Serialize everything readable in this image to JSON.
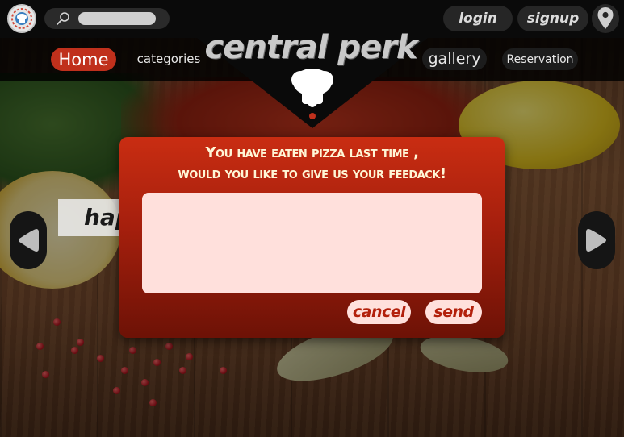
{
  "header": {
    "brand_title": "central perk",
    "search": {
      "value": "",
      "placeholder": ""
    },
    "login_label": "login",
    "signup_label": "signup",
    "location_icon": "map-pin-icon",
    "logo_icon": "chef-logo-icon"
  },
  "nav": {
    "items": [
      {
        "label": "Home",
        "active": true
      },
      {
        "label": "categories",
        "active": false
      },
      {
        "label": "gallery",
        "active": false
      },
      {
        "label": "Reservation",
        "active": false
      }
    ]
  },
  "carousel": {
    "caption": "happy",
    "prev_icon": "chevron-left-icon",
    "next_icon": "chevron-right-icon"
  },
  "dialog": {
    "message_line1": "You have eaten pizza last time ,",
    "message_line2": "would you like to give us your feedack!",
    "feedback": {
      "value": "",
      "placeholder": ""
    },
    "cancel_label": "cancel",
    "send_label": "send"
  },
  "colors": {
    "accent_red": "#c0301c",
    "dialog_top": "#c92d12",
    "dialog_bottom": "#6d1206",
    "input_bg": "#ffe0dc",
    "bar_dark": "#0a0a0a"
  }
}
